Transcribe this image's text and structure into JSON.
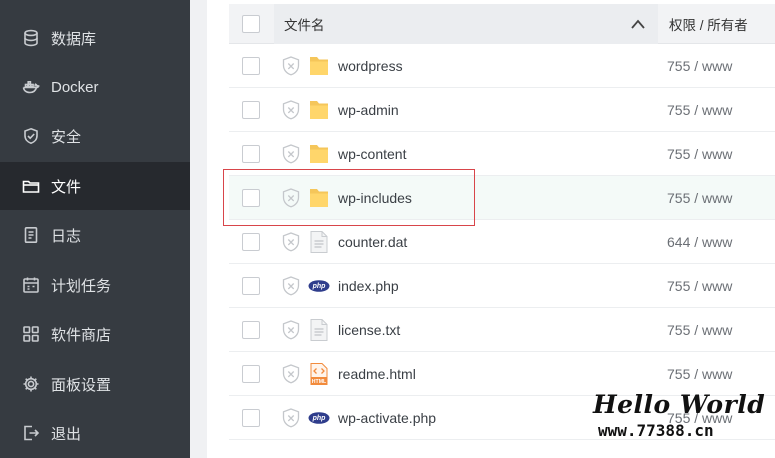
{
  "sidebar": {
    "items": [
      {
        "label": "数据库",
        "icon": "database-icon",
        "active": false
      },
      {
        "label": "Docker",
        "icon": "docker-icon",
        "active": false
      },
      {
        "label": "安全",
        "icon": "shield-check-icon",
        "active": false
      },
      {
        "label": "文件",
        "icon": "folder-icon",
        "active": true
      },
      {
        "label": "日志",
        "icon": "log-icon",
        "active": false
      },
      {
        "label": "计划任务",
        "icon": "calendar-icon",
        "active": false
      },
      {
        "label": "软件商店",
        "icon": "grid-icon",
        "active": false
      },
      {
        "label": "面板设置",
        "icon": "gear-icon",
        "active": false
      },
      {
        "label": "退出",
        "icon": "logout-icon",
        "active": false
      }
    ]
  },
  "table": {
    "headers": {
      "name": "文件名",
      "perm": "权限 / 所有者"
    },
    "rows": [
      {
        "name": "wordpress",
        "type": "folder",
        "perm": "755 / www"
      },
      {
        "name": "wp-admin",
        "type": "folder",
        "perm": "755 / www"
      },
      {
        "name": "wp-content",
        "type": "folder",
        "perm": "755 / www"
      },
      {
        "name": "wp-includes",
        "type": "folder",
        "perm": "755 / www",
        "highlighted": true
      },
      {
        "name": "counter.dat",
        "type": "text",
        "perm": "644 / www"
      },
      {
        "name": "index.php",
        "type": "php",
        "perm": "755 / www"
      },
      {
        "name": "license.txt",
        "type": "text",
        "perm": "755 / www"
      },
      {
        "name": "readme.html",
        "type": "html",
        "perm": "755 / www"
      },
      {
        "name": "wp-activate.php",
        "type": "php",
        "perm": "755 / www"
      }
    ]
  },
  "icons": {
    "php_text": "php",
    "html_text": "HTML"
  },
  "watermark": {
    "title": "Hello World",
    "url": "www.77388.cn"
  },
  "colors": {
    "sidebar_bg": "#363b41",
    "sidebar_active": "#26292e",
    "folder": "#f5c65a",
    "php": "#2f3d8c",
    "html": "#f28b3c",
    "selection_border": "#d8454a"
  }
}
